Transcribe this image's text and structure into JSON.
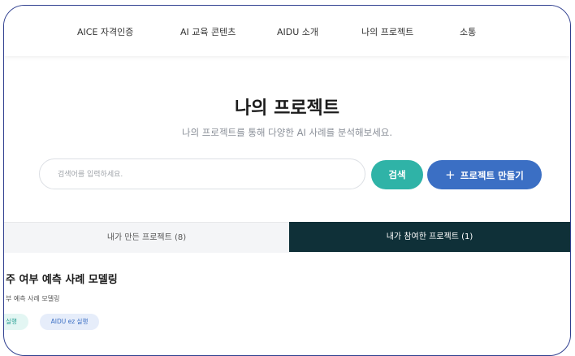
{
  "nav": {
    "items": [
      "AICE 자격인증",
      "AI 교육 콘텐츠",
      "AIDU 소개",
      "나의 프로젝트",
      "소통"
    ]
  },
  "page": {
    "title": "나의 프로젝트",
    "subtitle": "나의 프로젝트를 통해 다양한 AI 사례를 분석해보세요."
  },
  "search": {
    "placeholder": "검색어를 입력하세요.",
    "value": "",
    "button_label": "검색"
  },
  "create_button": {
    "icon": "plus-icon",
    "label": "프로젝트 만들기"
  },
  "tabs": [
    {
      "label": "내가 만든 프로젝트 (8)",
      "active": false
    },
    {
      "label": "내가 참여한 프로젝트 (1)",
      "active": true
    }
  ],
  "project_card": {
    "title": "주 여부 예측 사례 모델링",
    "description": "부 예측 사례 모델링",
    "tags": [
      "실행",
      "AIDU ez 실행"
    ]
  },
  "colors": {
    "frame_border": "#2f3f8f",
    "search_button": "#2fb3a7",
    "create_button": "#3b6fc4",
    "active_tab": "#0f3038"
  }
}
